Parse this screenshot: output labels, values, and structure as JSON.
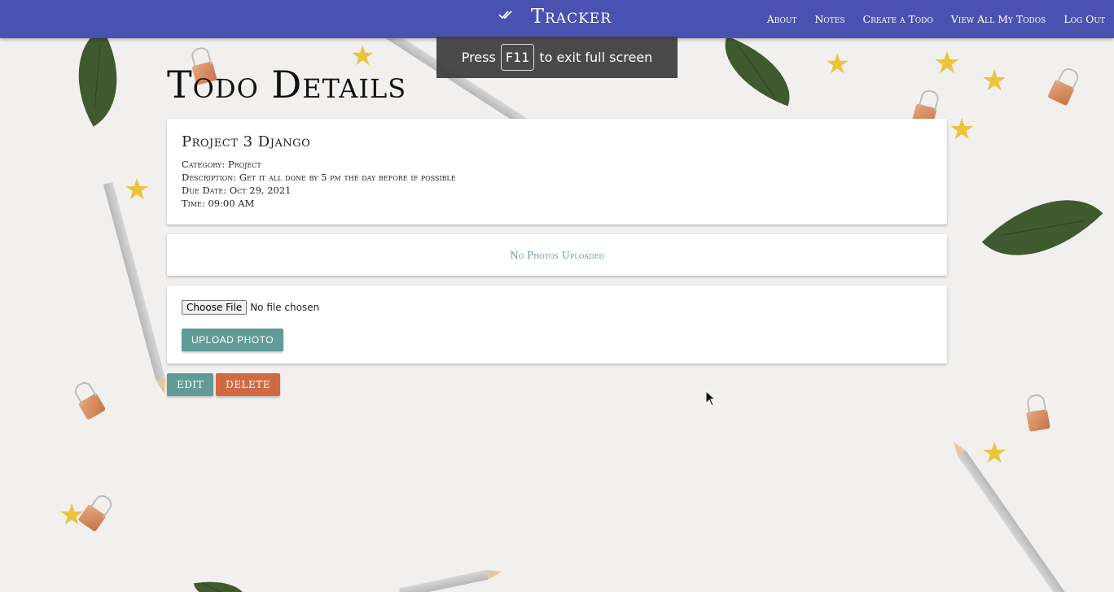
{
  "navbar": {
    "brand_icon": "double-check-icon",
    "brand": "Tracker",
    "links": [
      "About",
      "Notes",
      "Create a Todo",
      "View All My Todos",
      "Log Out"
    ]
  },
  "fullscreen_notice": {
    "before": "Press",
    "key": "F11",
    "after": "to exit full screen"
  },
  "page": {
    "title": "Todo Details"
  },
  "todo": {
    "title": "Project 3 Django",
    "category": "Category: Project",
    "description": "Description: Get it all done by 5 pm the day before if possible",
    "due_date": "Due Date: Oct 29, 2021",
    "time": "Time: 09:00 AM"
  },
  "photos": {
    "empty_text": "No Photos Uploaded"
  },
  "upload": {
    "choose_file_label": "Choose File",
    "file_status": "No file chosen",
    "upload_label": "UPLOAD PHOTO"
  },
  "actions": {
    "edit_label": "EDIT",
    "delete_label": "DELETE"
  },
  "colors": {
    "navbar": "#4a52b1",
    "teal": "#619b97",
    "delete": "#d06a45"
  }
}
